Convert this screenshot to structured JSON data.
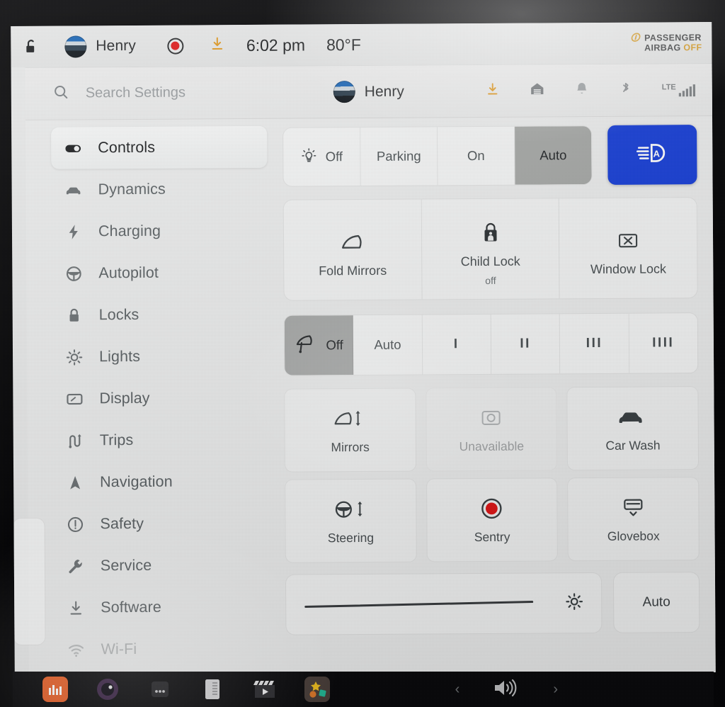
{
  "status_bar": {
    "lock_icon": "unlock-icon",
    "driver_name": "Henry",
    "dashcam_icon": "record-dot-icon",
    "download_icon": "download-icon",
    "time": "6:02 pm",
    "temperature": "80°F",
    "airbag": {
      "glyph": "passenger-airbag-glyph",
      "line1": "PASSENGER",
      "line2": "AIRBAG",
      "state": "OFF"
    }
  },
  "search": {
    "icon": "search-icon",
    "placeholder": "Search Settings",
    "profile_name": "Henry",
    "right_icons": [
      {
        "name": "download-icon",
        "label": "Software update"
      },
      {
        "name": "home-garage-icon",
        "label": "Home"
      },
      {
        "name": "bell-icon",
        "label": "Notifications"
      },
      {
        "name": "bluetooth-icon",
        "label": "Bluetooth"
      },
      {
        "name": "lte-signal-icon",
        "label": "LTE"
      }
    ],
    "lte_label": "LTE"
  },
  "sidebar": {
    "items": [
      {
        "label": "Controls",
        "icon": "toggle-icon",
        "active": true
      },
      {
        "label": "Dynamics",
        "icon": "car-icon",
        "active": false
      },
      {
        "label": "Charging",
        "icon": "bolt-icon",
        "active": false
      },
      {
        "label": "Autopilot",
        "icon": "steering-wheel-icon",
        "active": false
      },
      {
        "label": "Locks",
        "icon": "padlock-icon",
        "active": false
      },
      {
        "label": "Lights",
        "icon": "sun-icon",
        "active": false
      },
      {
        "label": "Display",
        "icon": "display-icon",
        "active": false
      },
      {
        "label": "Trips",
        "icon": "route-icon",
        "active": false
      },
      {
        "label": "Navigation",
        "icon": "navigation-arrow-icon",
        "active": false
      },
      {
        "label": "Safety",
        "icon": "warning-circle-icon",
        "active": false
      },
      {
        "label": "Service",
        "icon": "wrench-icon",
        "active": false
      },
      {
        "label": "Software",
        "icon": "download-icon",
        "active": false
      },
      {
        "label": "Wi-Fi",
        "icon": "wifi-icon",
        "active": false
      }
    ]
  },
  "controls": {
    "headlights": {
      "icon": "headlight-sun-icon",
      "options": [
        "Off",
        "Parking",
        "On",
        "Auto"
      ],
      "selected": "Auto",
      "auto_high_beam_button": {
        "icon": "auto-high-beam-icon",
        "active": true,
        "color": "#1a41d8"
      }
    },
    "mirror_strip": [
      {
        "label": "Fold Mirrors",
        "sub": "",
        "icon": "mirror-icon"
      },
      {
        "label": "Child Lock",
        "sub": "off",
        "icon": "child-lock-icon"
      },
      {
        "label": "Window Lock",
        "sub": "",
        "icon": "window-lock-icon"
      }
    ],
    "wipers": {
      "icon": "wiper-icon",
      "options": [
        "Off",
        "Auto",
        "I",
        "II",
        "III",
        "IIII"
      ],
      "selected": "Off"
    },
    "grid": [
      {
        "label": "Mirrors",
        "icon": "mirror-adjust-icon",
        "disabled": false
      },
      {
        "label": "Unavailable",
        "icon": "camera-icon",
        "disabled": true
      },
      {
        "label": "Car Wash",
        "icon": "car-wash-icon",
        "disabled": false
      },
      {
        "label": "Steering",
        "icon": "steering-adjust-icon",
        "disabled": false
      },
      {
        "label": "Sentry",
        "icon": "sentry-record-icon",
        "disabled": false
      },
      {
        "label": "Glovebox",
        "icon": "glovebox-icon",
        "disabled": false
      }
    ],
    "brightness": {
      "slider_value": 92,
      "sun_icon": "brightness-sun-icon",
      "auto_label": "Auto"
    }
  },
  "taskbar": {
    "apps": [
      {
        "name": "equalizer-app-icon"
      },
      {
        "name": "camera-app-icon"
      },
      {
        "name": "more-dots-icon"
      },
      {
        "name": "calendar-app-icon"
      },
      {
        "name": "video-app-icon"
      },
      {
        "name": "toybox-app-icon"
      }
    ],
    "volume_prev": "‹",
    "volume_icon": "speaker-icon",
    "volume_next": "›"
  }
}
